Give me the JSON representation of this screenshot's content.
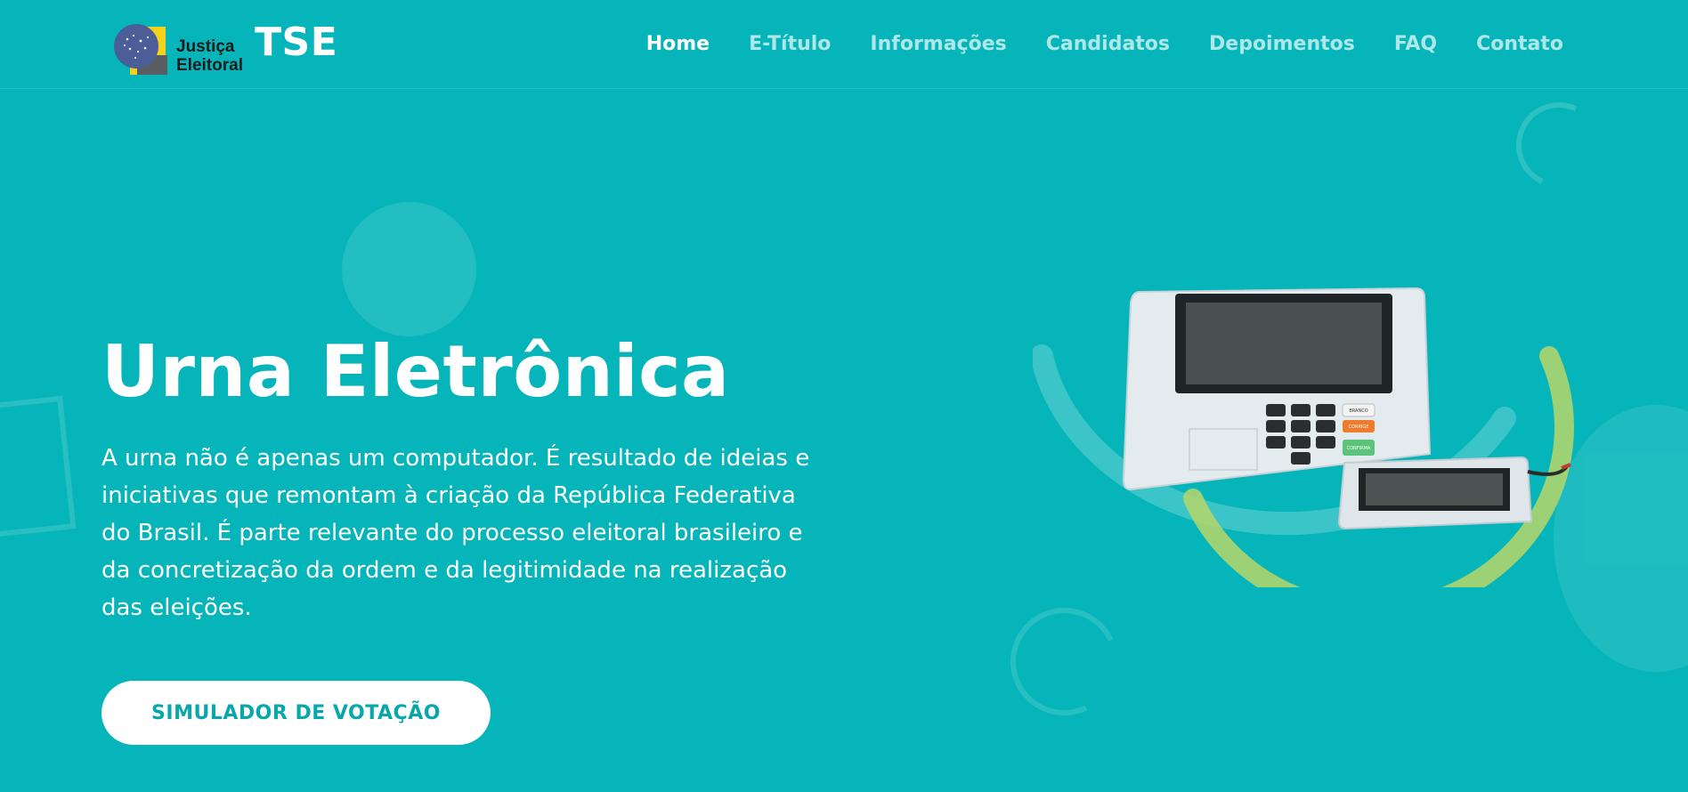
{
  "header": {
    "logo_line1": "Justiça",
    "logo_line2": "Eleitoral",
    "brand": "TSE",
    "nav": [
      {
        "label": "Home",
        "active": true
      },
      {
        "label": "E-Título",
        "active": false
      },
      {
        "label": "Informações",
        "active": false
      },
      {
        "label": "Candidatos",
        "active": false
      },
      {
        "label": "Depoimentos",
        "active": false
      },
      {
        "label": "FAQ",
        "active": false
      },
      {
        "label": "Contato",
        "active": false
      }
    ]
  },
  "hero": {
    "title": "Urna Eletrônica",
    "text": "A urna não é apenas um computador. É resultado de ideias e iniciativas que remontam à criação da República Federativa do Brasil. É parte relevante do processo eleitoral brasileiro e da concretização da ordem e da legitimidade na realização das eleições.",
    "cta_label": "SIMULADOR DE VOTAÇÃO"
  },
  "illustration": {
    "keypad_labels": [
      "BRANCO",
      "CORRIGE",
      "CONFIRMA"
    ]
  },
  "colors": {
    "background": "#05b5b9",
    "cta_text": "#08a6ad",
    "accent_green": "#b7d66a"
  }
}
